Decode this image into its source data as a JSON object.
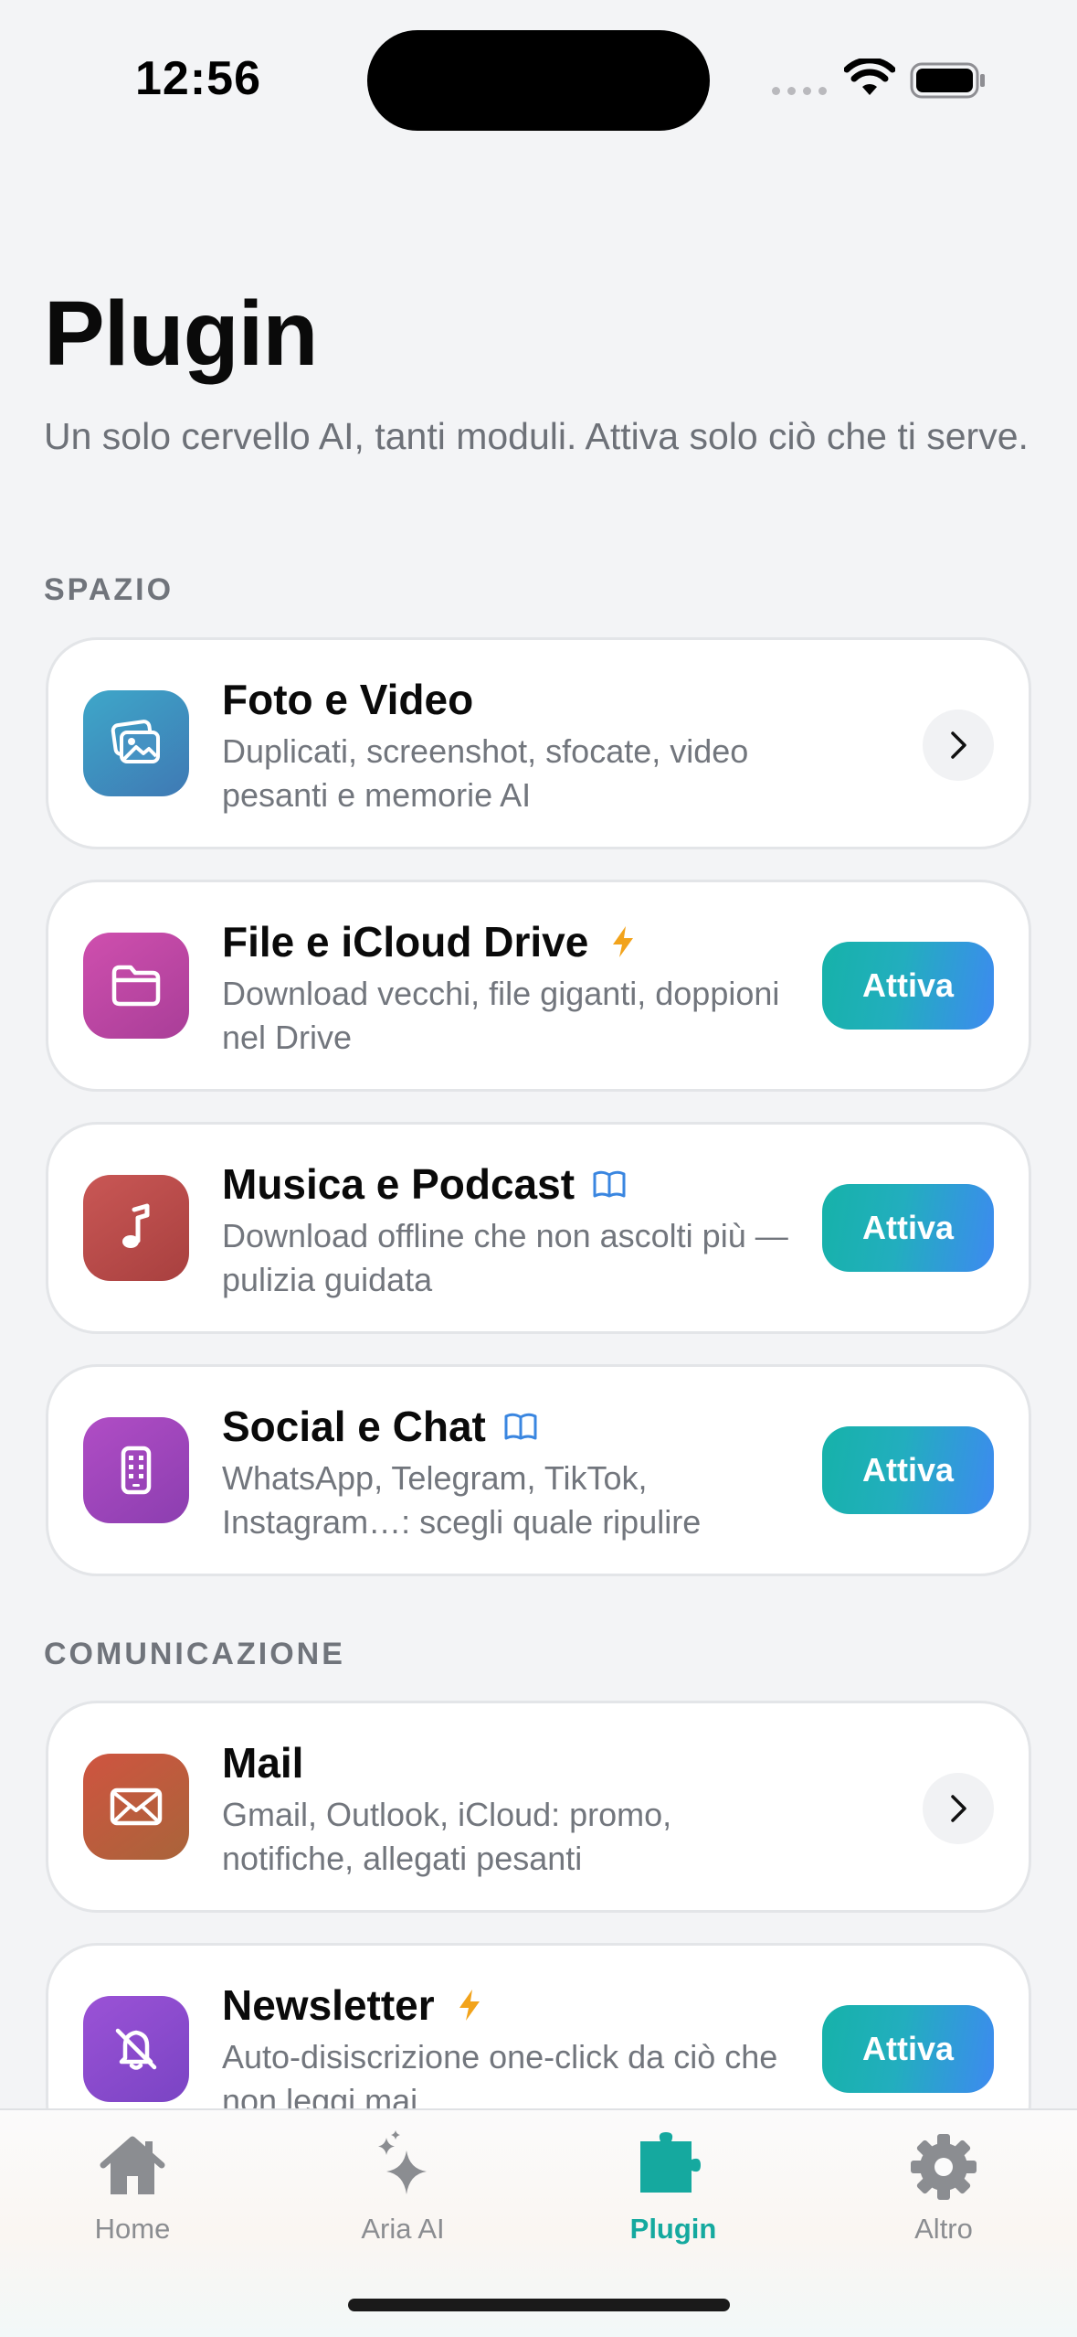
{
  "status_bar": {
    "time": "12:56"
  },
  "header": {
    "title": "Plugin",
    "subtitle": "Un solo cervello AI, tanti moduli. Attiva solo ciò che ti serve."
  },
  "sections": [
    {
      "label": "SPAZIO"
    },
    {
      "label": "COMUNICAZIONE"
    }
  ],
  "plugins": [
    {
      "title": "Foto e Video",
      "description": "Duplicati, screenshot, sfocate, video pesanti e memorie AI",
      "icon": "photos-icon",
      "badge": "",
      "action": "chevron"
    },
    {
      "title": "File e iCloud Drive",
      "description": "Download vecchi, file giganti, doppioni nel Drive",
      "icon": "folder-icon",
      "badge": "bolt-icon",
      "action": "Attiva"
    },
    {
      "title": "Musica e Podcast",
      "description": "Download offline che non ascolti più — pulizia guidata",
      "icon": "music-note-icon",
      "badge": "book-icon",
      "action": "Attiva"
    },
    {
      "title": "Social e Chat",
      "description": "WhatsApp, Telegram, TikTok, Instagram…: scegli quale ripulire",
      "icon": "phone-icon",
      "badge": "book-icon",
      "action": "Attiva"
    },
    {
      "title": "Mail",
      "description": "Gmail, Outlook, iCloud: promo, notifiche, allegati pesanti",
      "icon": "envelope-icon",
      "badge": "",
      "action": "chevron"
    },
    {
      "title": "Newsletter",
      "description": "Auto-disiscrizione one-click da ciò che non leggi mai",
      "icon": "bell-slash-icon",
      "badge": "bolt-icon",
      "action": "Attiva"
    }
  ],
  "tabs": [
    {
      "label": "Home",
      "icon": "house-icon",
      "active": false
    },
    {
      "label": "Aria AI",
      "icon": "sparkles-icon",
      "active": false
    },
    {
      "label": "Plugin",
      "icon": "puzzle-icon",
      "active": true
    },
    {
      "label": "Altro",
      "icon": "gear-icon",
      "active": false
    }
  ],
  "colors": {
    "accent": "#15a99f",
    "button_gradient_start": "#16b2a9",
    "button_gradient_end": "#3d8af0",
    "bolt": "#f2a31b",
    "book": "#3a86e0"
  }
}
